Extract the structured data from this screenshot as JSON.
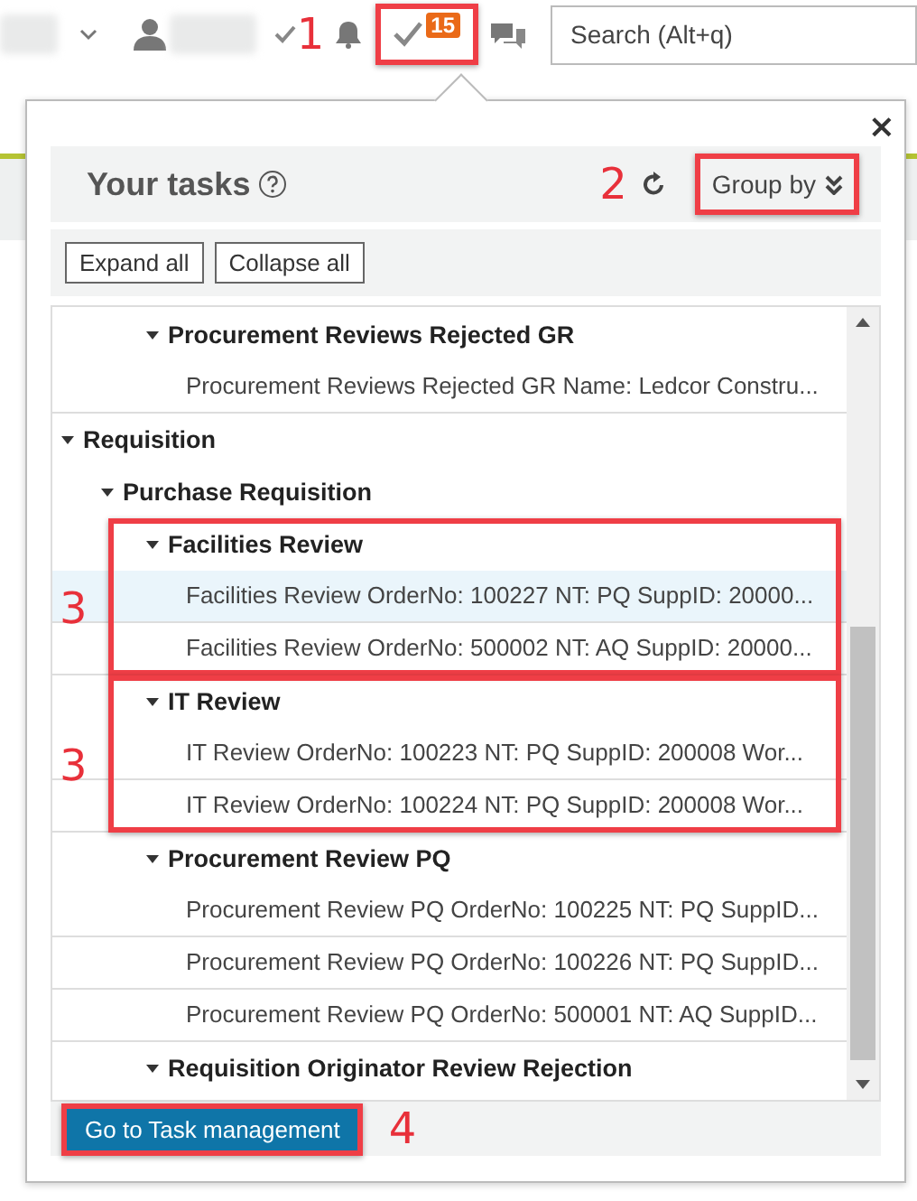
{
  "top_bar": {
    "task_count": "15",
    "task_button_highlighted": true,
    "callout": "1",
    "search": {
      "placeholder": "Search (Alt+q)"
    }
  },
  "panel": {
    "close": "×",
    "title": "Your tasks",
    "group_by": {
      "label": "Group by",
      "highlighted": true,
      "callout": "2"
    },
    "buttons": [
      "Expand all",
      "Collapse all"
    ],
    "tree": [
      {
        "children": [
          {
            "children": [
              {
                "label": "Procurement Reviews Rejected GR",
                "expanded": true,
                "children": [
                  {
                    "label": "Procurement Reviews Rejected GR Name: Ledcor Constru...",
                    "selected": false
                  }
                ]
              }
            ]
          }
        ]
      },
      {
        "label": "Requisition",
        "expanded": true,
        "children": [
          {
            "label": "Purchase Requisition",
            "expanded": true,
            "children": [
              {
                "label": "Facilities Review",
                "expanded": true,
                "highlighted": true,
                "callout": "3",
                "children": [
                  {
                    "label": "Facilities Review OrderNo: 100227 NT: PQ SuppID: 20000...",
                    "selected": true
                  },
                  {
                    "label": "Facilities Review OrderNo: 500002 NT: AQ SuppID: 20000...",
                    "selected": false
                  }
                ]
              },
              {
                "label": "IT Review",
                "expanded": true,
                "highlighted": true,
                "callout": "3",
                "children": [
                  {
                    "label": "IT Review OrderNo: 100223 NT: PQ SuppID: 200008 Wor...",
                    "selected": false
                  },
                  {
                    "label": "IT Review OrderNo: 100224 NT: PQ SuppID: 200008 Wor...",
                    "selected": false
                  }
                ]
              },
              {
                "label": "Procurement Review PQ",
                "expanded": true,
                "children": [
                  {
                    "label": "Procurement Review PQ OrderNo: 100225 NT: PQ SuppID...",
                    "selected": false
                  },
                  {
                    "label": "Procurement Review PQ OrderNo: 100226 NT: PQ SuppID...",
                    "selected": false
                  },
                  {
                    "label": "Procurement Review PQ OrderNo: 500001 NT: AQ SuppID...",
                    "selected": false
                  }
                ]
              },
              {
                "label": "Requisition Originator Review Rejection",
                "expanded": true
              }
            ]
          }
        ]
      }
    ],
    "footer_button": {
      "label": "Go to Task management",
      "highlighted": true,
      "callout": "4"
    }
  }
}
